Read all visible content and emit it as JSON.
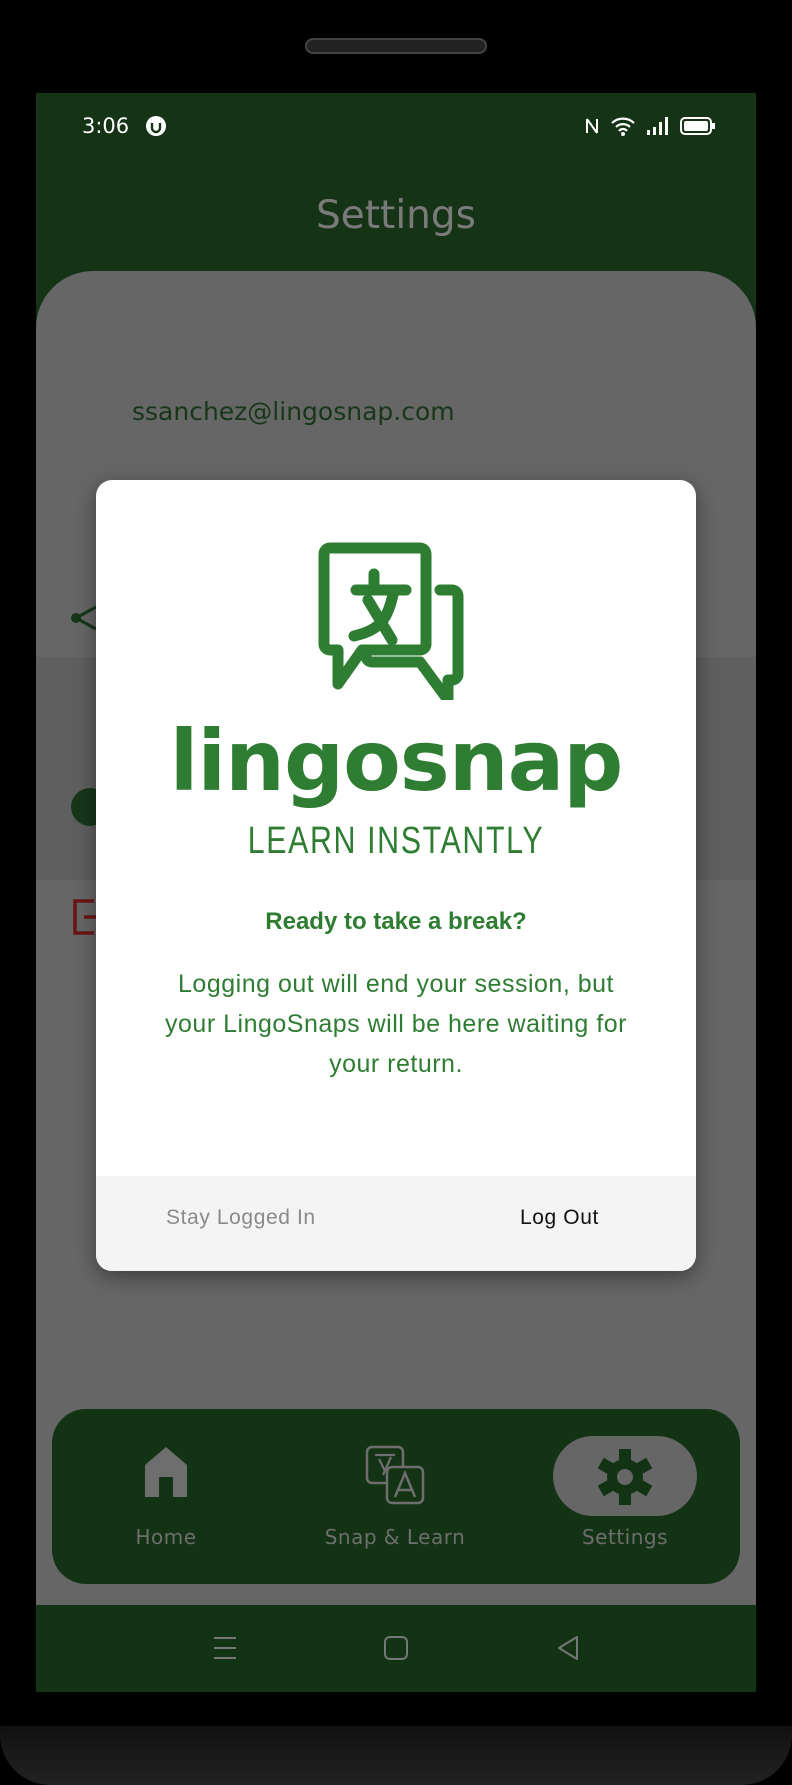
{
  "status_bar": {
    "time": "3:06"
  },
  "header": {
    "title": "Settings"
  },
  "account": {
    "email": "ssanchez@lingosnap.com"
  },
  "dialog": {
    "logo_wordmark": "lingosnap",
    "logo_tagline": "LEARN INSTANTLY",
    "heading": "Ready to take a break?",
    "message": "Logging out will end your session, but your LingoSnaps will be here waiting for your return.",
    "cancel_label": "Stay Logged In",
    "confirm_label": "Log Out"
  },
  "bottom_nav": {
    "items": [
      {
        "label": "Home",
        "icon": "home-icon"
      },
      {
        "label": "Snap & Learn",
        "icon": "translate-icon"
      },
      {
        "label": "Settings",
        "icon": "gear-icon",
        "active": true
      }
    ]
  },
  "colors": {
    "brand_green": "#2e7d32",
    "dark_green": "#143415",
    "overlay_gray": "#666666"
  }
}
